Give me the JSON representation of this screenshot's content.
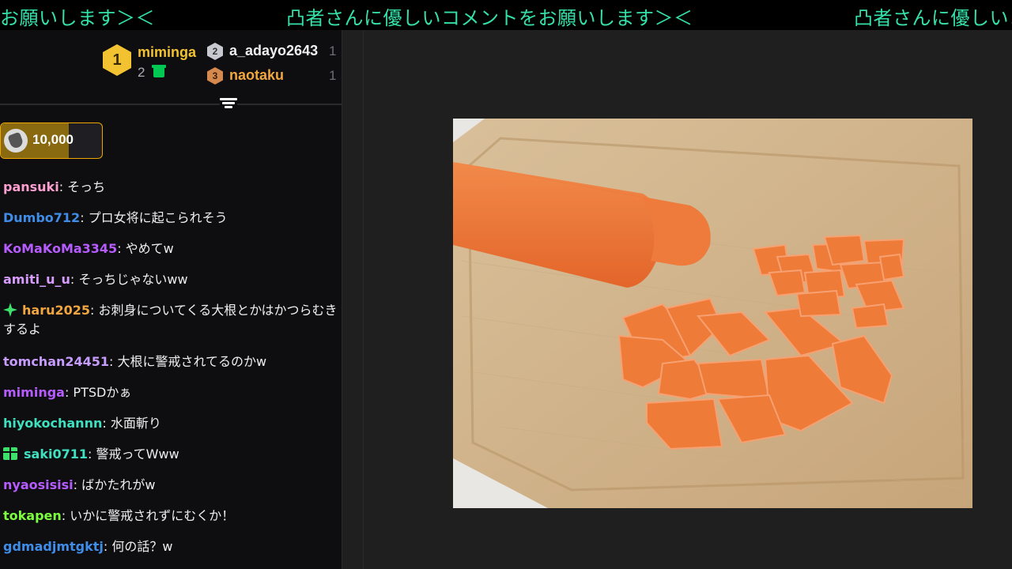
{
  "ticker": {
    "segments": [
      "お願いします＞＜",
      "凸者さんに優しいコメントをお願いします＞＜",
      "凸者さんに優しいコメントをお願いします＞＜"
    ],
    "color": "#35e0a8"
  },
  "leaderboard": {
    "first": {
      "rank": "1",
      "name": "miminga",
      "count": "2",
      "icon": "gift-icon"
    },
    "second": {
      "rank": "2",
      "name": "a_adayo2643",
      "count": "1"
    },
    "third": {
      "rank": "3",
      "name": "naotaku",
      "count": "1"
    }
  },
  "pinned": {
    "amount": "10,000",
    "icon": "cheer-icon"
  },
  "messages": [
    {
      "user": "pansuki",
      "color": "#ff9ed0",
      "text": ": そっち"
    },
    {
      "user": "Dumbo712",
      "color": "#3f8de8",
      "text": ": プロ女将に起こられそう"
    },
    {
      "user": "KoMaKoMa3345",
      "color": "#b65cff",
      "text": ": やめてw"
    },
    {
      "user": "amiti_u_u",
      "color": "#d89cff",
      "text": ": そっちじゃないww"
    },
    {
      "user": "haru2025",
      "color": "#f2a640",
      "text": ": お刺身についてくる大根とかはかつらむきするよ",
      "badge": "star-badge-icon"
    },
    {
      "user": "tomchan24451",
      "color": "#c79cff",
      "text": ": 大根に警戒されてるのかw"
    },
    {
      "user": "miminga",
      "color": "#b65cff",
      "text": ": PTSDかぁ"
    },
    {
      "user": "hiyokochannn",
      "color": "#3ee0c0",
      "text": ": 水面斬り"
    },
    {
      "user": "saki0711",
      "color": "#3ee0c0",
      "text": ": 警戒ってWww",
      "badge": "gift-badge-icon"
    },
    {
      "user": "nyaosisisi",
      "color": "#b65cff",
      "text": ": ばかたれがw"
    },
    {
      "user": "tokapen",
      "color": "#7cff3e",
      "text": ": いかに警戒されずにむくか！"
    },
    {
      "user": "gdmadjmtgktj",
      "color": "#3f8de8",
      "text": ": 何の話？w"
    }
  ]
}
